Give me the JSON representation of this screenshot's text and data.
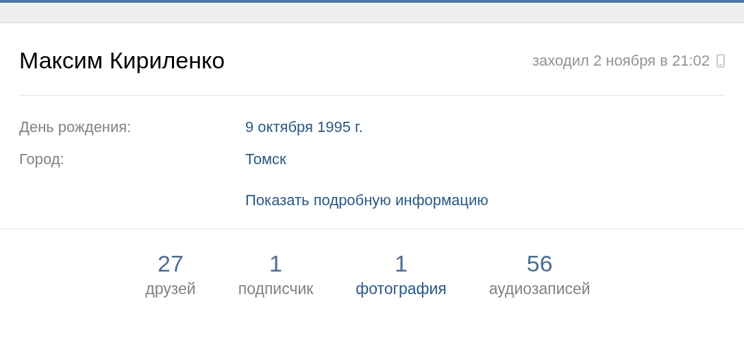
{
  "profile": {
    "name": "Максим Кириленко",
    "last_seen": "заходил 2 ноября в 21:02"
  },
  "info": [
    {
      "label": "День рождения:",
      "value": "9 октября 1995 г."
    },
    {
      "label": "Город:",
      "value": "Томск"
    }
  ],
  "more_link": "Показать подробную информацию",
  "counters": [
    {
      "count": "27",
      "label": "друзей",
      "highlighted": false
    },
    {
      "count": "1",
      "label": "подписчик",
      "highlighted": false
    },
    {
      "count": "1",
      "label": "фотография",
      "highlighted": true
    },
    {
      "count": "56",
      "label": "аудиозаписей",
      "highlighted": false
    }
  ]
}
